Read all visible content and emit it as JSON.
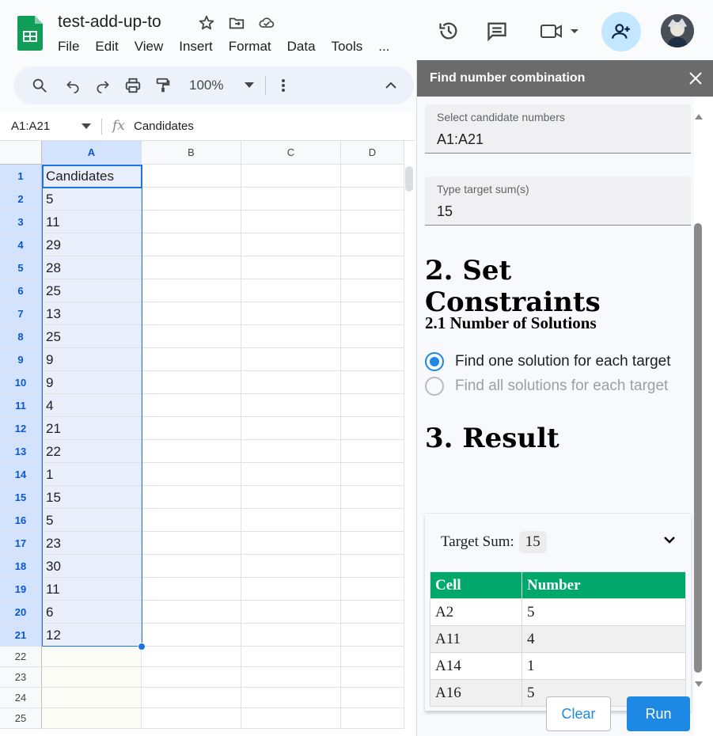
{
  "app": {
    "doc_title": "test-add-up-to",
    "menu": [
      "File",
      "Edit",
      "View",
      "Insert",
      "Format",
      "Data",
      "Tools",
      "..."
    ],
    "zoom": "100%"
  },
  "formula_bar": {
    "name_box": "A1:A21",
    "fx": "fx",
    "content": "Candidates"
  },
  "sheet": {
    "columns": [
      "A",
      "B",
      "C",
      "D"
    ],
    "rows": [
      {
        "n": "1",
        "a": "Candidates"
      },
      {
        "n": "2",
        "a": "5"
      },
      {
        "n": "3",
        "a": "11"
      },
      {
        "n": "4",
        "a": "29"
      },
      {
        "n": "5",
        "a": "28"
      },
      {
        "n": "6",
        "a": "25"
      },
      {
        "n": "7",
        "a": "13"
      },
      {
        "n": "8",
        "a": "25"
      },
      {
        "n": "9",
        "a": "9"
      },
      {
        "n": "10",
        "a": "9"
      },
      {
        "n": "11",
        "a": "4"
      },
      {
        "n": "12",
        "a": "21"
      },
      {
        "n": "13",
        "a": "22"
      },
      {
        "n": "14",
        "a": "1"
      },
      {
        "n": "15",
        "a": "15"
      },
      {
        "n": "16",
        "a": "5"
      },
      {
        "n": "17",
        "a": "23"
      },
      {
        "n": "18",
        "a": "30"
      },
      {
        "n": "19",
        "a": "11"
      },
      {
        "n": "20",
        "a": "6"
      },
      {
        "n": "21",
        "a": "12"
      },
      {
        "n": "22",
        "a": ""
      },
      {
        "n": "23",
        "a": ""
      },
      {
        "n": "24",
        "a": ""
      },
      {
        "n": "25",
        "a": ""
      }
    ]
  },
  "panel": {
    "title": "Find number combination",
    "candidate_label": "Select candidate numbers",
    "candidate_value": "A1:A21",
    "target_label": "Type target sum(s)",
    "target_value": "15",
    "constraints_heading": "2. Set Constraints",
    "solutions_heading": "2.1 Number of Solutions",
    "option_one": "Find one solution for each target",
    "option_all": "Find all solutions for each target",
    "result_heading": "3. Result",
    "target_sum_label": "Target Sum:",
    "target_sum_value": "15",
    "table_headers": [
      "Cell",
      "Number"
    ],
    "table_rows": [
      [
        "A2",
        "5"
      ],
      [
        "A11",
        "4"
      ],
      [
        "A14",
        "1"
      ],
      [
        "A16",
        "5"
      ]
    ],
    "clear_label": "Clear",
    "run_label": "Run"
  },
  "colors": {
    "accent": "#1e88e5",
    "table_header": "#00a86b",
    "panel_header": "#6b6b6b"
  }
}
